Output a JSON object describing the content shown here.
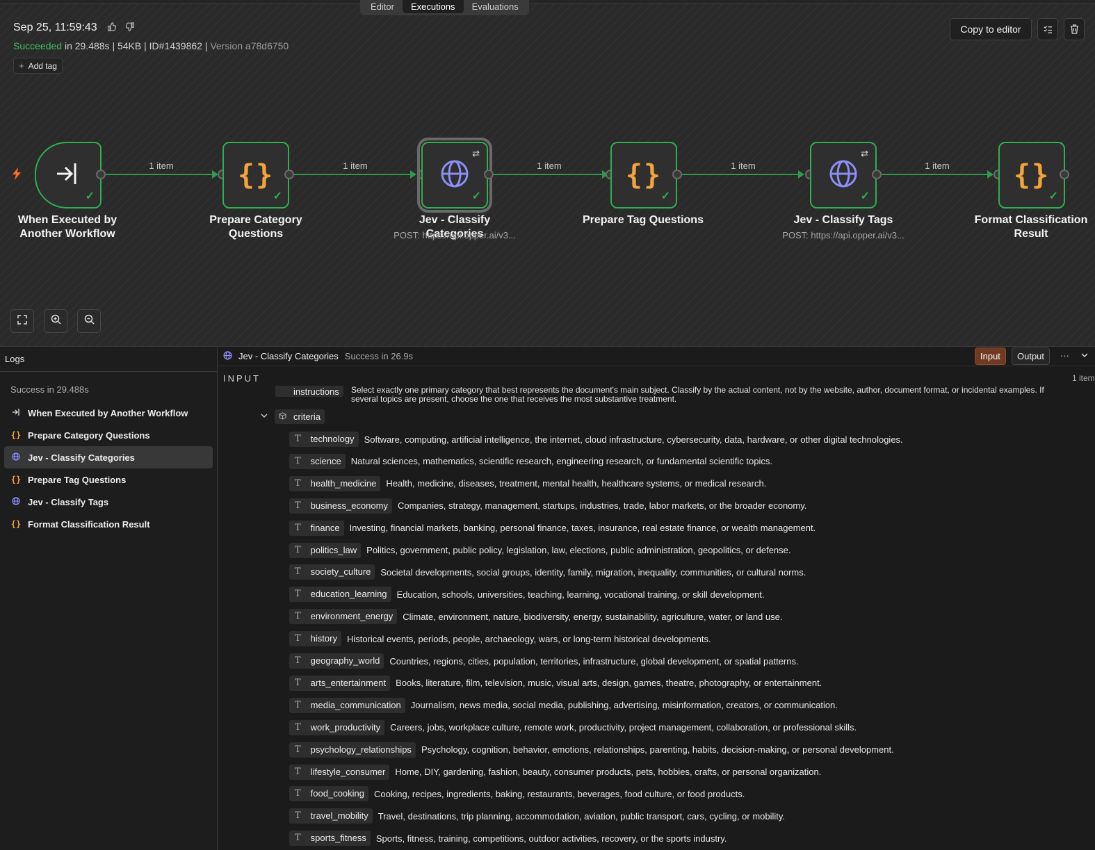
{
  "view_tabs": [
    "Editor",
    "Executions",
    "Evaluations"
  ],
  "execution": {
    "date": "Sep 25, 11:59:43",
    "status": "Succeeded",
    "details": " in 29.488s | 54KB | ID#1439862 | ",
    "version": "Version a78d6750",
    "add_tag": "Add tag",
    "copy_to_editor": "Copy to editor"
  },
  "workflow": {
    "connection_label": "1 item",
    "nodes": [
      {
        "title": "When Executed by Another Workflow",
        "subtitle": "",
        "kind": "trigger"
      },
      {
        "title": "Prepare Category Questions",
        "subtitle": "",
        "kind": "code"
      },
      {
        "title": "Jev - Classify Categories",
        "subtitle": "POST: https://api.opper.ai/v3...",
        "kind": "http"
      },
      {
        "title": "Prepare Tag Questions",
        "subtitle": "",
        "kind": "code"
      },
      {
        "title": "Jev - Classify Tags",
        "subtitle": "POST: https://api.opper.ai/v3...",
        "kind": "http"
      },
      {
        "title": "Format Classification Result",
        "subtitle": "",
        "kind": "code"
      }
    ]
  },
  "logs": {
    "title": "Logs",
    "summary": "Success in 29.488s",
    "items": [
      {
        "label": "When Executed by Another Workflow",
        "icon": "trigger-icon"
      },
      {
        "label": "Prepare Category Questions",
        "icon": "code-icon"
      },
      {
        "label": "Jev - Classify Categories",
        "icon": "globe-icon"
      },
      {
        "label": "Prepare Tag Questions",
        "icon": "code-icon"
      },
      {
        "label": "Jev - Classify Tags",
        "icon": "globe-icon"
      },
      {
        "label": "Format Classification Result",
        "icon": "code-icon"
      }
    ]
  },
  "panel": {
    "node_name": "Jev - Classify Categories",
    "status": "Success in 26.9s",
    "input_btn": "Input",
    "output_btn": "Output",
    "section_label": "INPUT",
    "items_count": "1 item",
    "instructions_key": "instructions",
    "instructions_text": "Select exactly one primary category that best represents the document's main subject. Classify by the actual content, not by the website, author, document format, or incidental examples. If several topics are present, choose the one that receives the most substantive treatment.",
    "criteria_key": "criteria",
    "criteria": [
      {
        "key": "technology",
        "value": "Software, computing, artificial intelligence, the internet, cloud infrastructure, cybersecurity, data, hardware, or other digital technologies."
      },
      {
        "key": "science",
        "value": "Natural sciences, mathematics, scientific research, engineering research, or fundamental scientific topics."
      },
      {
        "key": "health_medicine",
        "value": "Health, medicine, diseases, treatment, mental health, healthcare systems, or medical research."
      },
      {
        "key": "business_economy",
        "value": "Companies, strategy, management, startups, industries, trade, labor markets, or the broader economy."
      },
      {
        "key": "finance",
        "value": "Investing, financial markets, banking, personal finance, taxes, insurance, real estate finance, or wealth management."
      },
      {
        "key": "politics_law",
        "value": "Politics, government, public policy, legislation, law, elections, public administration, geopolitics, or defense."
      },
      {
        "key": "society_culture",
        "value": "Societal developments, social groups, identity, family, migration, inequality, communities, or cultural norms."
      },
      {
        "key": "education_learning",
        "value": "Education, schools, universities, teaching, learning, vocational training, or skill development."
      },
      {
        "key": "environment_energy",
        "value": "Climate, environment, nature, biodiversity, energy, sustainability, agriculture, water, or land use."
      },
      {
        "key": "history",
        "value": "Historical events, periods, people, archaeology, wars, or long-term historical developments."
      },
      {
        "key": "geography_world",
        "value": "Countries, regions, cities, population, territories, infrastructure, global development, or spatial patterns."
      },
      {
        "key": "arts_entertainment",
        "value": "Books, literature, film, television, music, visual arts, design, games, theatre, photography, or entertainment."
      },
      {
        "key": "media_communication",
        "value": "Journalism, news media, social media, publishing, advertising, misinformation, creators, or communication."
      },
      {
        "key": "work_productivity",
        "value": "Careers, jobs, workplace culture, remote work, productivity, project management, collaboration, or professional skills."
      },
      {
        "key": "psychology_relationships",
        "value": "Psychology, cognition, behavior, emotions, relationships, parenting, habits, decision-making, or personal development."
      },
      {
        "key": "lifestyle_consumer",
        "value": "Home, DIY, gardening, fashion, beauty, consumer products, pets, hobbies, crafts, or personal organization."
      },
      {
        "key": "food_cooking",
        "value": "Cooking, recipes, ingredients, baking, restaurants, beverages, food culture, or food products."
      },
      {
        "key": "travel_mobility",
        "value": "Travel, destinations, trip planning, accommodation, aviation, public transport, cars, cycling, or mobility."
      },
      {
        "key": "sports_fitness",
        "value": "Sports, fitness, training, competitions, outdoor activities, recovery, or the sports industry."
      }
    ]
  }
}
